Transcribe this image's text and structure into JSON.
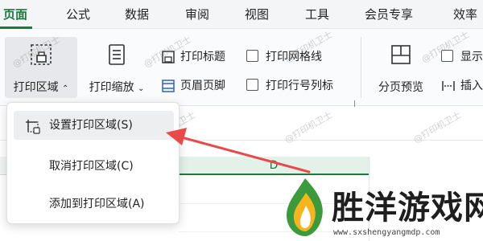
{
  "tabs": [
    {
      "label": "页面",
      "active": true
    },
    {
      "label": "公式"
    },
    {
      "label": "数据"
    },
    {
      "label": "审阅"
    },
    {
      "label": "视图"
    },
    {
      "label": "工具"
    },
    {
      "label": "会员专享"
    },
    {
      "label": "效率"
    }
  ],
  "ribbon": {
    "print_area": "打印区域",
    "print_scale": "打印缩放",
    "print_titles": "打印标题",
    "header_footer": "页眉页脚",
    "print_gridlines": "打印网格线",
    "print_row_col_headers": "打印行号列标",
    "page_break_preview": "分页预览",
    "show": "显示",
    "insert": "插入"
  },
  "menu": {
    "items": [
      {
        "label": "设置打印区域(S)"
      },
      {
        "label": "取消打印区域(C)"
      },
      {
        "label": "添加到打印区域(A)"
      }
    ]
  },
  "sheet": {
    "column_d": "D"
  },
  "watermark": "@打印机卫士",
  "logo": {
    "text": "胜洋游戏网",
    "url": "www.sxshengyangmdp.com"
  },
  "colors": {
    "accent": "#1c7a3e",
    "arrow": "#e84a4a"
  }
}
